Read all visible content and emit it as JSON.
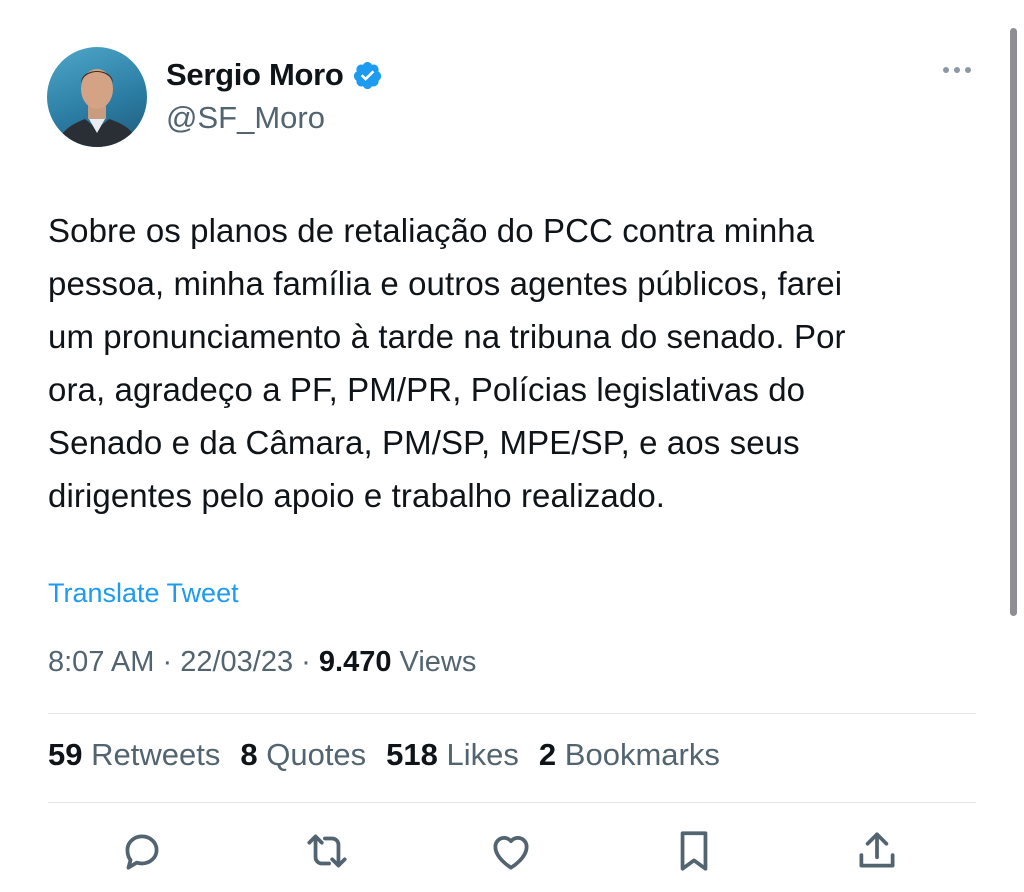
{
  "author": {
    "display_name": "Sergio Moro",
    "handle": "@SF_Moro",
    "verified": true,
    "avatar_icon": "profile-photo"
  },
  "tweet": {
    "text": "Sobre os planos de retaliação do PCC contra minha\npessoa, minha família e outros agentes públicos, farei\num pronunciamento à tarde na tribuna do senado. Por\nora, agradeço a PF, PM/PR, Polícias legislativas do\nSenado e da Câmara, PM/SP, MPE/SP, e aos seus\ndirigentes pelo apoio e trabalho realizado.",
    "translate_label": "Translate Tweet",
    "time": "8:07 AM",
    "separator": "·",
    "date": "22/03/23",
    "views_count": "9.470",
    "views_label": "Views"
  },
  "stats": {
    "retweets_count": "59",
    "retweets_label": "Retweets",
    "quotes_count": "8",
    "quotes_label": "Quotes",
    "likes_count": "518",
    "likes_label": "Likes",
    "bookmarks_count": "2",
    "bookmarks_label": "Bookmarks"
  },
  "actions": [
    "reply-icon",
    "retweet-icon",
    "like-icon",
    "bookmark-icon",
    "share-icon"
  ],
  "colors": {
    "link": "#1d9bf0",
    "secondary_text": "#536471",
    "primary_text": "#0f1419",
    "verified_badge": "#1d9bf0"
  }
}
